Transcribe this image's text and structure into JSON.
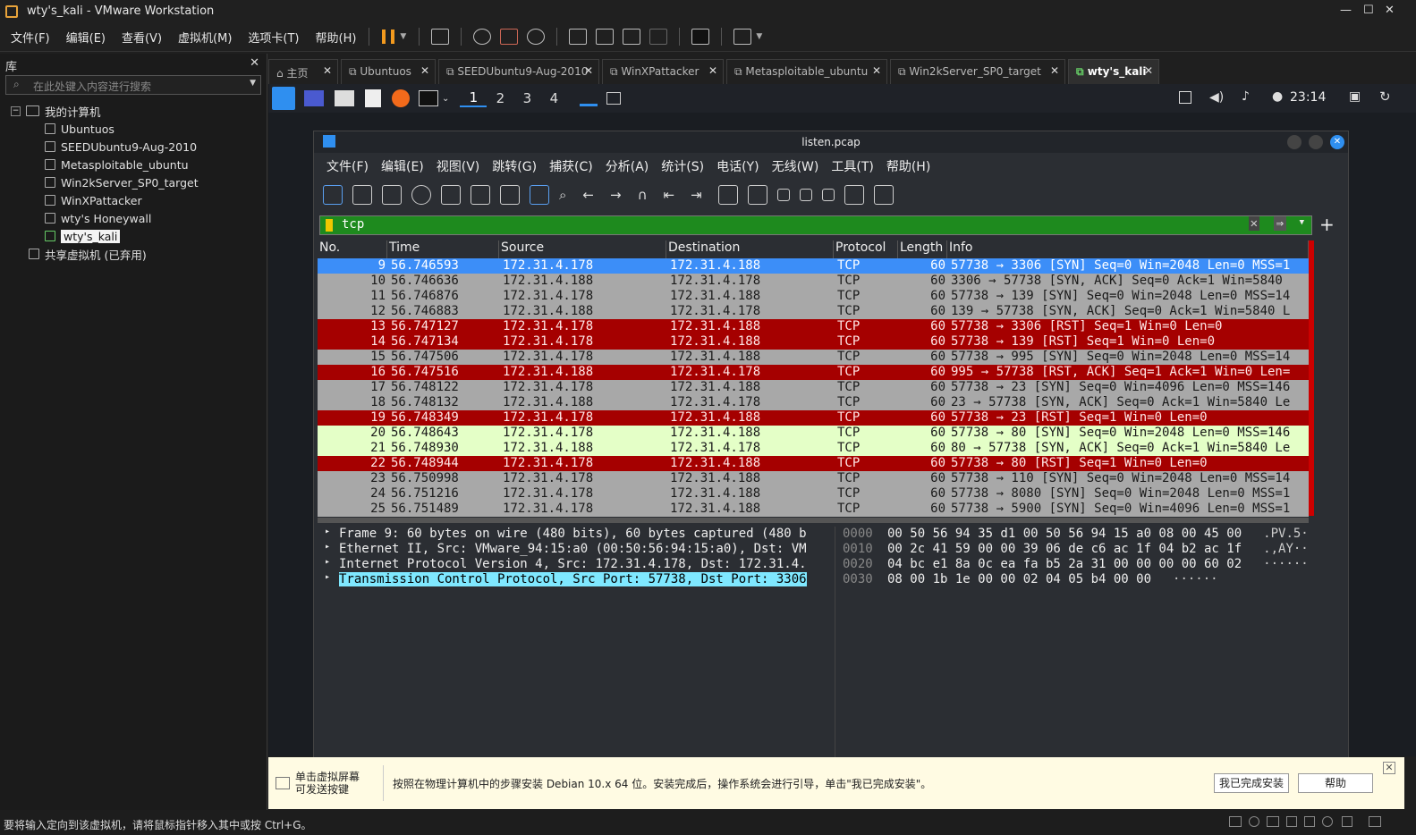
{
  "window": {
    "title": "wty's_kali - VMware Workstation"
  },
  "menu": [
    "文件(F)",
    "编辑(E)",
    "查看(V)",
    "虚拟机(M)",
    "选项卡(T)",
    "帮助(H)"
  ],
  "library": {
    "title": "库",
    "search_placeholder": "在此处键入内容进行搜索",
    "root": "我的计算机",
    "vms": [
      "Ubuntuos",
      "SEEDUbuntu9-Aug-2010",
      "Metasploitable_ubuntu",
      "Win2kServer_SP0_target",
      "WinXPattacker",
      "wty's Honeywall",
      "wty's_kali"
    ],
    "shared": "共享虚拟机 (已弃用)"
  },
  "tabs": [
    "主页",
    "Ubuntuos",
    "SEEDUbuntu9-Aug-2010",
    "WinXPattacker",
    "Metasploitable_ubuntu",
    "Win2kServer_SP0_target",
    "wty's_kali"
  ],
  "kali": {
    "workspaces": [
      "1",
      "2",
      "3",
      "4"
    ],
    "clock": "23:14"
  },
  "wireshark": {
    "title": "listen.pcap",
    "menu": [
      "文件(F)",
      "编辑(E)",
      "视图(V)",
      "跳转(G)",
      "捕获(C)",
      "分析(A)",
      "统计(S)",
      "电话(Y)",
      "无线(W)",
      "工具(T)",
      "帮助(H)"
    ],
    "filter": "tcp",
    "columns": [
      "No.",
      "Time",
      "Source",
      "Destination",
      "Protocol",
      "Length",
      "Info"
    ],
    "packets": [
      {
        "no": "9",
        "time": "56.746593",
        "src": "172.31.4.178",
        "dst": "172.31.4.188",
        "proto": "TCP",
        "len": "60",
        "info": "57738 → 3306 [SYN] Seq=0 Win=2048 Len=0 MSS=1",
        "color": "blue"
      },
      {
        "no": "10",
        "time": "56.746636",
        "src": "172.31.4.188",
        "dst": "172.31.4.178",
        "proto": "TCP",
        "len": "60",
        "info": "3306 → 57738 [SYN, ACK] Seq=0 Ack=1 Win=5840",
        "color": "gray"
      },
      {
        "no": "11",
        "time": "56.746876",
        "src": "172.31.4.178",
        "dst": "172.31.4.188",
        "proto": "TCP",
        "len": "60",
        "info": "57738 → 139 [SYN] Seq=0 Win=2048 Len=0 MSS=14",
        "color": "gray"
      },
      {
        "no": "12",
        "time": "56.746883",
        "src": "172.31.4.188",
        "dst": "172.31.4.178",
        "proto": "TCP",
        "len": "60",
        "info": "139 → 57738 [SYN, ACK] Seq=0 Ack=1 Win=5840 L",
        "color": "gray"
      },
      {
        "no": "13",
        "time": "56.747127",
        "src": "172.31.4.178",
        "dst": "172.31.4.188",
        "proto": "TCP",
        "len": "60",
        "info": "57738 → 3306 [RST] Seq=1 Win=0 Len=0",
        "color": "red"
      },
      {
        "no": "14",
        "time": "56.747134",
        "src": "172.31.4.178",
        "dst": "172.31.4.188",
        "proto": "TCP",
        "len": "60",
        "info": "57738 → 139 [RST] Seq=1 Win=0 Len=0",
        "color": "red"
      },
      {
        "no": "15",
        "time": "56.747506",
        "src": "172.31.4.178",
        "dst": "172.31.4.188",
        "proto": "TCP",
        "len": "60",
        "info": "57738 → 995 [SYN] Seq=0 Win=2048 Len=0 MSS=14",
        "color": "gray"
      },
      {
        "no": "16",
        "time": "56.747516",
        "src": "172.31.4.188",
        "dst": "172.31.4.178",
        "proto": "TCP",
        "len": "60",
        "info": "995 → 57738 [RST, ACK] Seq=1 Ack=1 Win=0 Len=",
        "color": "red"
      },
      {
        "no": "17",
        "time": "56.748122",
        "src": "172.31.4.178",
        "dst": "172.31.4.188",
        "proto": "TCP",
        "len": "60",
        "info": "57738 → 23 [SYN] Seq=0 Win=4096 Len=0 MSS=146",
        "color": "gray"
      },
      {
        "no": "18",
        "time": "56.748132",
        "src": "172.31.4.188",
        "dst": "172.31.4.178",
        "proto": "TCP",
        "len": "60",
        "info": "23 → 57738 [SYN, ACK] Seq=0 Ack=1 Win=5840 Le",
        "color": "gray"
      },
      {
        "no": "19",
        "time": "56.748349",
        "src": "172.31.4.178",
        "dst": "172.31.4.188",
        "proto": "TCP",
        "len": "60",
        "info": "57738 → 23 [RST] Seq=1 Win=0 Len=0",
        "color": "red"
      },
      {
        "no": "20",
        "time": "56.748643",
        "src": "172.31.4.178",
        "dst": "172.31.4.188",
        "proto": "TCP",
        "len": "60",
        "info": "57738 → 80 [SYN] Seq=0 Win=2048 Len=0 MSS=146",
        "color": "green"
      },
      {
        "no": "21",
        "time": "56.748930",
        "src": "172.31.4.188",
        "dst": "172.31.4.178",
        "proto": "TCP",
        "len": "60",
        "info": "80 → 57738 [SYN, ACK] Seq=0 Ack=1 Win=5840 Le",
        "color": "green"
      },
      {
        "no": "22",
        "time": "56.748944",
        "src": "172.31.4.178",
        "dst": "172.31.4.188",
        "proto": "TCP",
        "len": "60",
        "info": "57738 → 80 [RST] Seq=1 Win=0 Len=0",
        "color": "red"
      },
      {
        "no": "23",
        "time": "56.750998",
        "src": "172.31.4.178",
        "dst": "172.31.4.188",
        "proto": "TCP",
        "len": "60",
        "info": "57738 → 110 [SYN] Seq=0 Win=2048 Len=0 MSS=14",
        "color": "gray"
      },
      {
        "no": "24",
        "time": "56.751216",
        "src": "172.31.4.178",
        "dst": "172.31.4.188",
        "proto": "TCP",
        "len": "60",
        "info": "57738 → 8080 [SYN] Seq=0 Win=2048 Len=0 MSS=1",
        "color": "gray"
      },
      {
        "no": "25",
        "time": "56.751489",
        "src": "172.31.4.178",
        "dst": "172.31.4.188",
        "proto": "TCP",
        "len": "60",
        "info": "57738 → 5900 [SYN] Seq=0 Win=4096 Len=0 MSS=1",
        "color": "gray"
      }
    ],
    "details": [
      "Frame 9: 60 bytes on wire (480 bits), 60 bytes captured (480 b",
      "Ethernet II, Src: VMware_94:15:a0 (00:50:56:94:15:a0), Dst: VM",
      "Internet Protocol Version 4, Src: 172.31.4.178, Dst: 172.31.4.",
      "Transmission Control Protocol, Src Port: 57738, Dst Port: 3306"
    ],
    "hex": [
      {
        "off": "0000",
        "bytes": "00 50 56 94 35 d1 00 50  56 94 15 a0 08 00 45 00",
        "ascii": ".PV.5·"
      },
      {
        "off": "0010",
        "bytes": "00 2c 41 59 00 00 39 06  de c6 ac 1f 04 b2 ac 1f",
        "ascii": ".,AY··"
      },
      {
        "off": "0020",
        "bytes": "04 bc e1 8a 0c ea fa b5  2a 31 00 00 00 00 60 02",
        "ascii": "······"
      },
      {
        "off": "0030",
        "bytes": "08 00 1b 1e 00 00 02 04  05 b4 00 00",
        "ascii": "······"
      }
    ]
  },
  "install_bar": {
    "hint": "单击虚拟屏幕\n可发送按键",
    "message": "按照在物理计算机中的步骤安装 Debian 10.x 64 位。安装完成后，操作系统会进行引导，单击\"我已完成安装\"。",
    "done": "我已完成安装",
    "help": "帮助"
  },
  "status": "要将输入定向到该虚拟机，请将鼠标指针移入其中或按 Ctrl+G。"
}
